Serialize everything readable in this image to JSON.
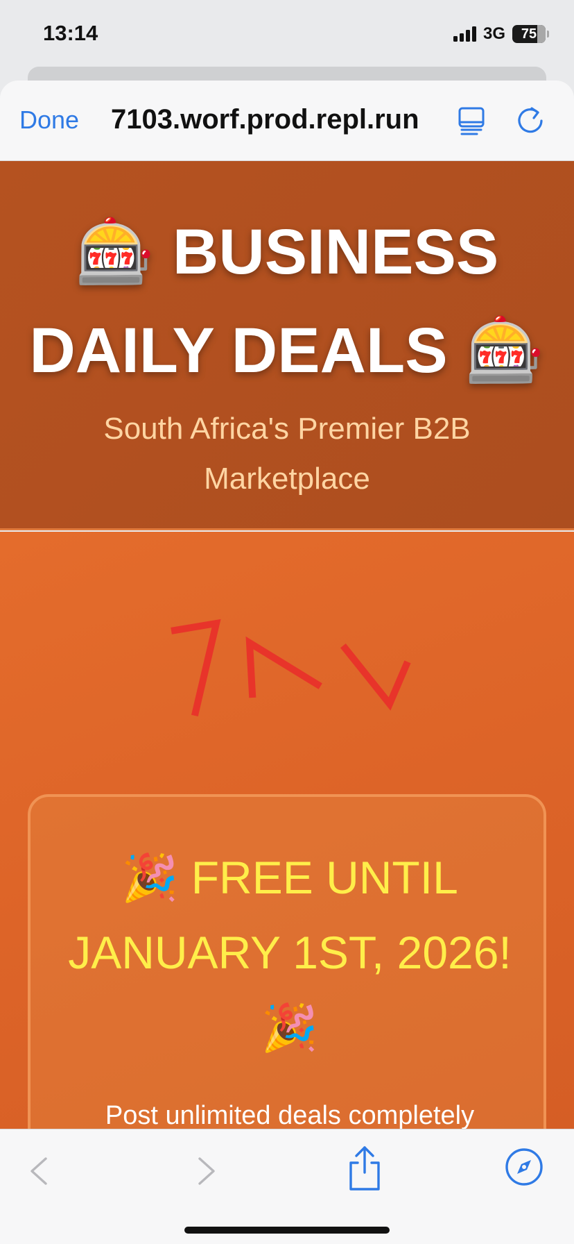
{
  "status_bar": {
    "time": "13:14",
    "network": "3G",
    "battery": "75"
  },
  "browser": {
    "done_label": "Done",
    "url": "7103.worf.prod.repl.run",
    "accent": "#2f7ae5"
  },
  "page": {
    "title_line1": "🎰 BUSINESS",
    "title_line2": "DAILY DEALS 🎰",
    "subtitle": "South Africa's Premier B2B Marketplace",
    "promo_title": "🎉 FREE UNTIL JANUARY 1ST, 2026! 🎉",
    "promo_text": "Post unlimited deals completely",
    "colors": {
      "header_bg": "#b55220",
      "main_bg": "#e46c2c",
      "promo_text": "#ffee4a",
      "subtitle": "#ffd5a3",
      "scribble": "#e8342a"
    }
  },
  "icons": {
    "reader": "reader-mode-icon",
    "reload": "reload-icon",
    "back": "chevron-left-icon",
    "forward": "chevron-right-icon",
    "share": "share-icon",
    "safari": "compass-icon"
  }
}
